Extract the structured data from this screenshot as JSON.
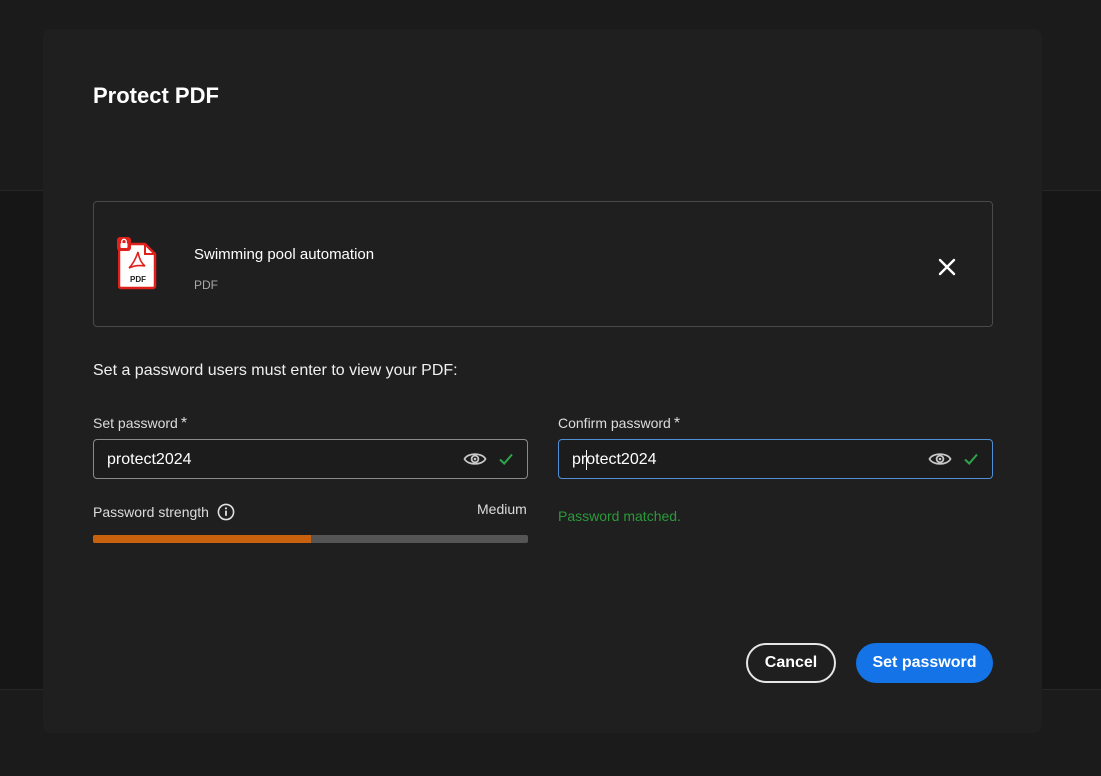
{
  "dialog": {
    "title": "Protect PDF",
    "file": {
      "name": "Swimming pool automation",
      "type": "PDF",
      "icon_label": "PDF"
    },
    "instructions": "Set a password users must enter to view your PDF:",
    "set_password": {
      "label": "Set password",
      "required_mark": "*",
      "value": "protect2024"
    },
    "confirm_password": {
      "label": "Confirm password",
      "required_mark": "*",
      "value": "protect2024"
    },
    "strength": {
      "label": "Password strength",
      "value": "Medium",
      "level": 0.5
    },
    "match_message": "Password matched.",
    "buttons": {
      "cancel": "Cancel",
      "submit": "Set password"
    }
  },
  "colors": {
    "accent": "#1473e6",
    "strength_fill": "#c7610d",
    "success": "#2b9a3a",
    "pdf_red": "#e0201b"
  }
}
